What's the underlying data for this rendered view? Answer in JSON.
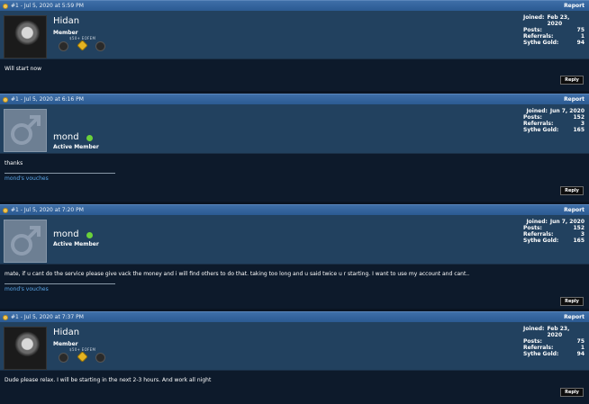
{
  "posts": [
    {
      "header": "#1 - Jul 5, 2020 at 5:59 PM",
      "report": "Report",
      "username": "Hidan",
      "usertitle": "Member",
      "badge_label": "$50+ EOFEM",
      "avatar": "hidan-avatar",
      "online": false,
      "stats": {
        "joined_label": "Joined:",
        "joined": "Feb 23, 2020",
        "posts_label": "Posts:",
        "posts": "75",
        "referrals_label": "Referrals:",
        "referrals": "1",
        "gold_label": "Sythe Gold:",
        "gold": "94"
      },
      "message": "Will start now",
      "vouches": "",
      "reply": "Reply"
    },
    {
      "header": "#1 - Jul 5, 2020 at 6:16 PM",
      "report": "Report",
      "username": "mond",
      "usertitle": "Active Member",
      "avatar": "default-male-avatar",
      "online": true,
      "stats": {
        "joined_label": "Joined:",
        "joined": "Jun 7, 2020",
        "posts_label": "Posts:",
        "posts": "152",
        "referrals_label": "Referrals:",
        "referrals": "3",
        "gold_label": "Sythe Gold:",
        "gold": "165"
      },
      "message": "thanks",
      "vouches": "mond's vouches",
      "reply": "Reply"
    },
    {
      "header": "#1 - Jul 5, 2020 at 7:20 PM",
      "report": "Report",
      "username": "mond",
      "usertitle": "Active Member",
      "avatar": "default-male-avatar",
      "online": true,
      "stats": {
        "joined_label": "Joined:",
        "joined": "Jun 7, 2020",
        "posts_label": "Posts:",
        "posts": "152",
        "referrals_label": "Referrals:",
        "referrals": "3",
        "gold_label": "Sythe Gold:",
        "gold": "165"
      },
      "message": "mate, if u cant do the service please give vack the money and i will find others to do that. taking too long and u said twice u r starting. I want to use my account and cant..",
      "vouches": "mond's vouches",
      "reply": "Reply"
    },
    {
      "header": "#1 - Jul 5, 2020 at 7:37 PM",
      "report": "Report",
      "username": "Hidan",
      "usertitle": "Member",
      "badge_label": "$50+ EOFEM",
      "avatar": "hidan-avatar",
      "online": false,
      "stats": {
        "joined_label": "Joined:",
        "joined": "Feb 23, 2020",
        "posts_label": "Posts:",
        "posts": "75",
        "referrals_label": "Referrals:",
        "referrals": "1",
        "gold_label": "Sythe Gold:",
        "gold": "94"
      },
      "message": "Dude please relax. I will be starting in the next 2-3 hours. And work all night",
      "vouches": "",
      "reply": "Reply"
    }
  ],
  "colors": {
    "header": "#2b5a92",
    "userinfo": "#22415f",
    "body": "#0d1a2b",
    "link": "#5aa6e8",
    "online": "#6bd13a"
  }
}
